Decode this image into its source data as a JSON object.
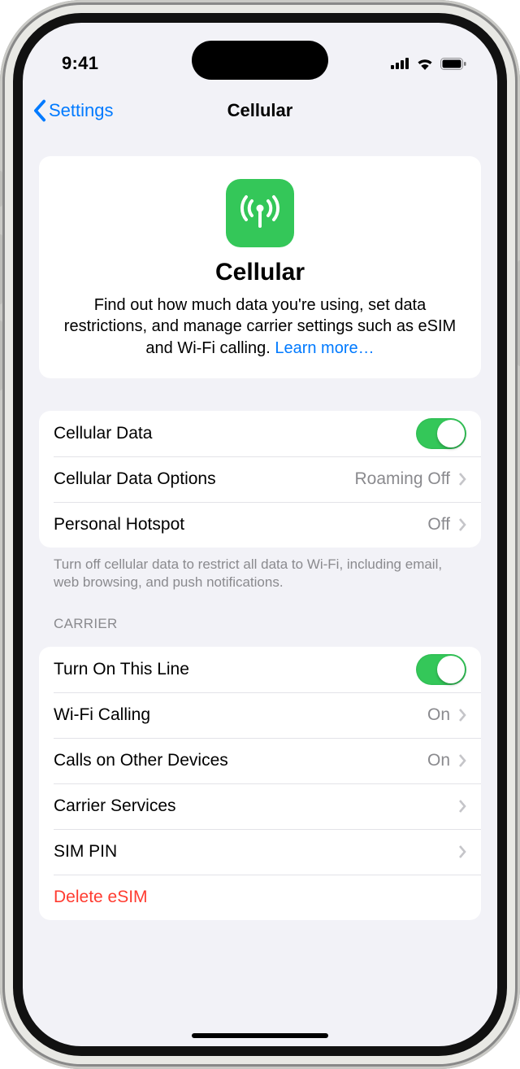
{
  "status": {
    "time": "9:41"
  },
  "nav": {
    "back": "Settings",
    "title": "Cellular"
  },
  "hero": {
    "title": "Cellular",
    "description": "Find out how much data you're using, set data restrictions, and manage carrier settings such as eSIM and Wi-Fi calling. ",
    "learn_more": "Learn more…"
  },
  "data_group": {
    "cellular_data": "Cellular Data",
    "options_label": "Cellular Data Options",
    "options_value": "Roaming Off",
    "hotspot_label": "Personal Hotspot",
    "hotspot_value": "Off",
    "footer": "Turn off cellular data to restrict all data to Wi-Fi, including email, web browsing, and push notifications."
  },
  "carrier": {
    "header": "CARRIER",
    "turn_on": "Turn On This Line",
    "wifi_calling_label": "Wi-Fi Calling",
    "wifi_calling_value": "On",
    "other_devices_label": "Calls on Other Devices",
    "other_devices_value": "On",
    "carrier_services": "Carrier Services",
    "sim_pin": "SIM PIN",
    "delete_esim": "Delete eSIM"
  }
}
